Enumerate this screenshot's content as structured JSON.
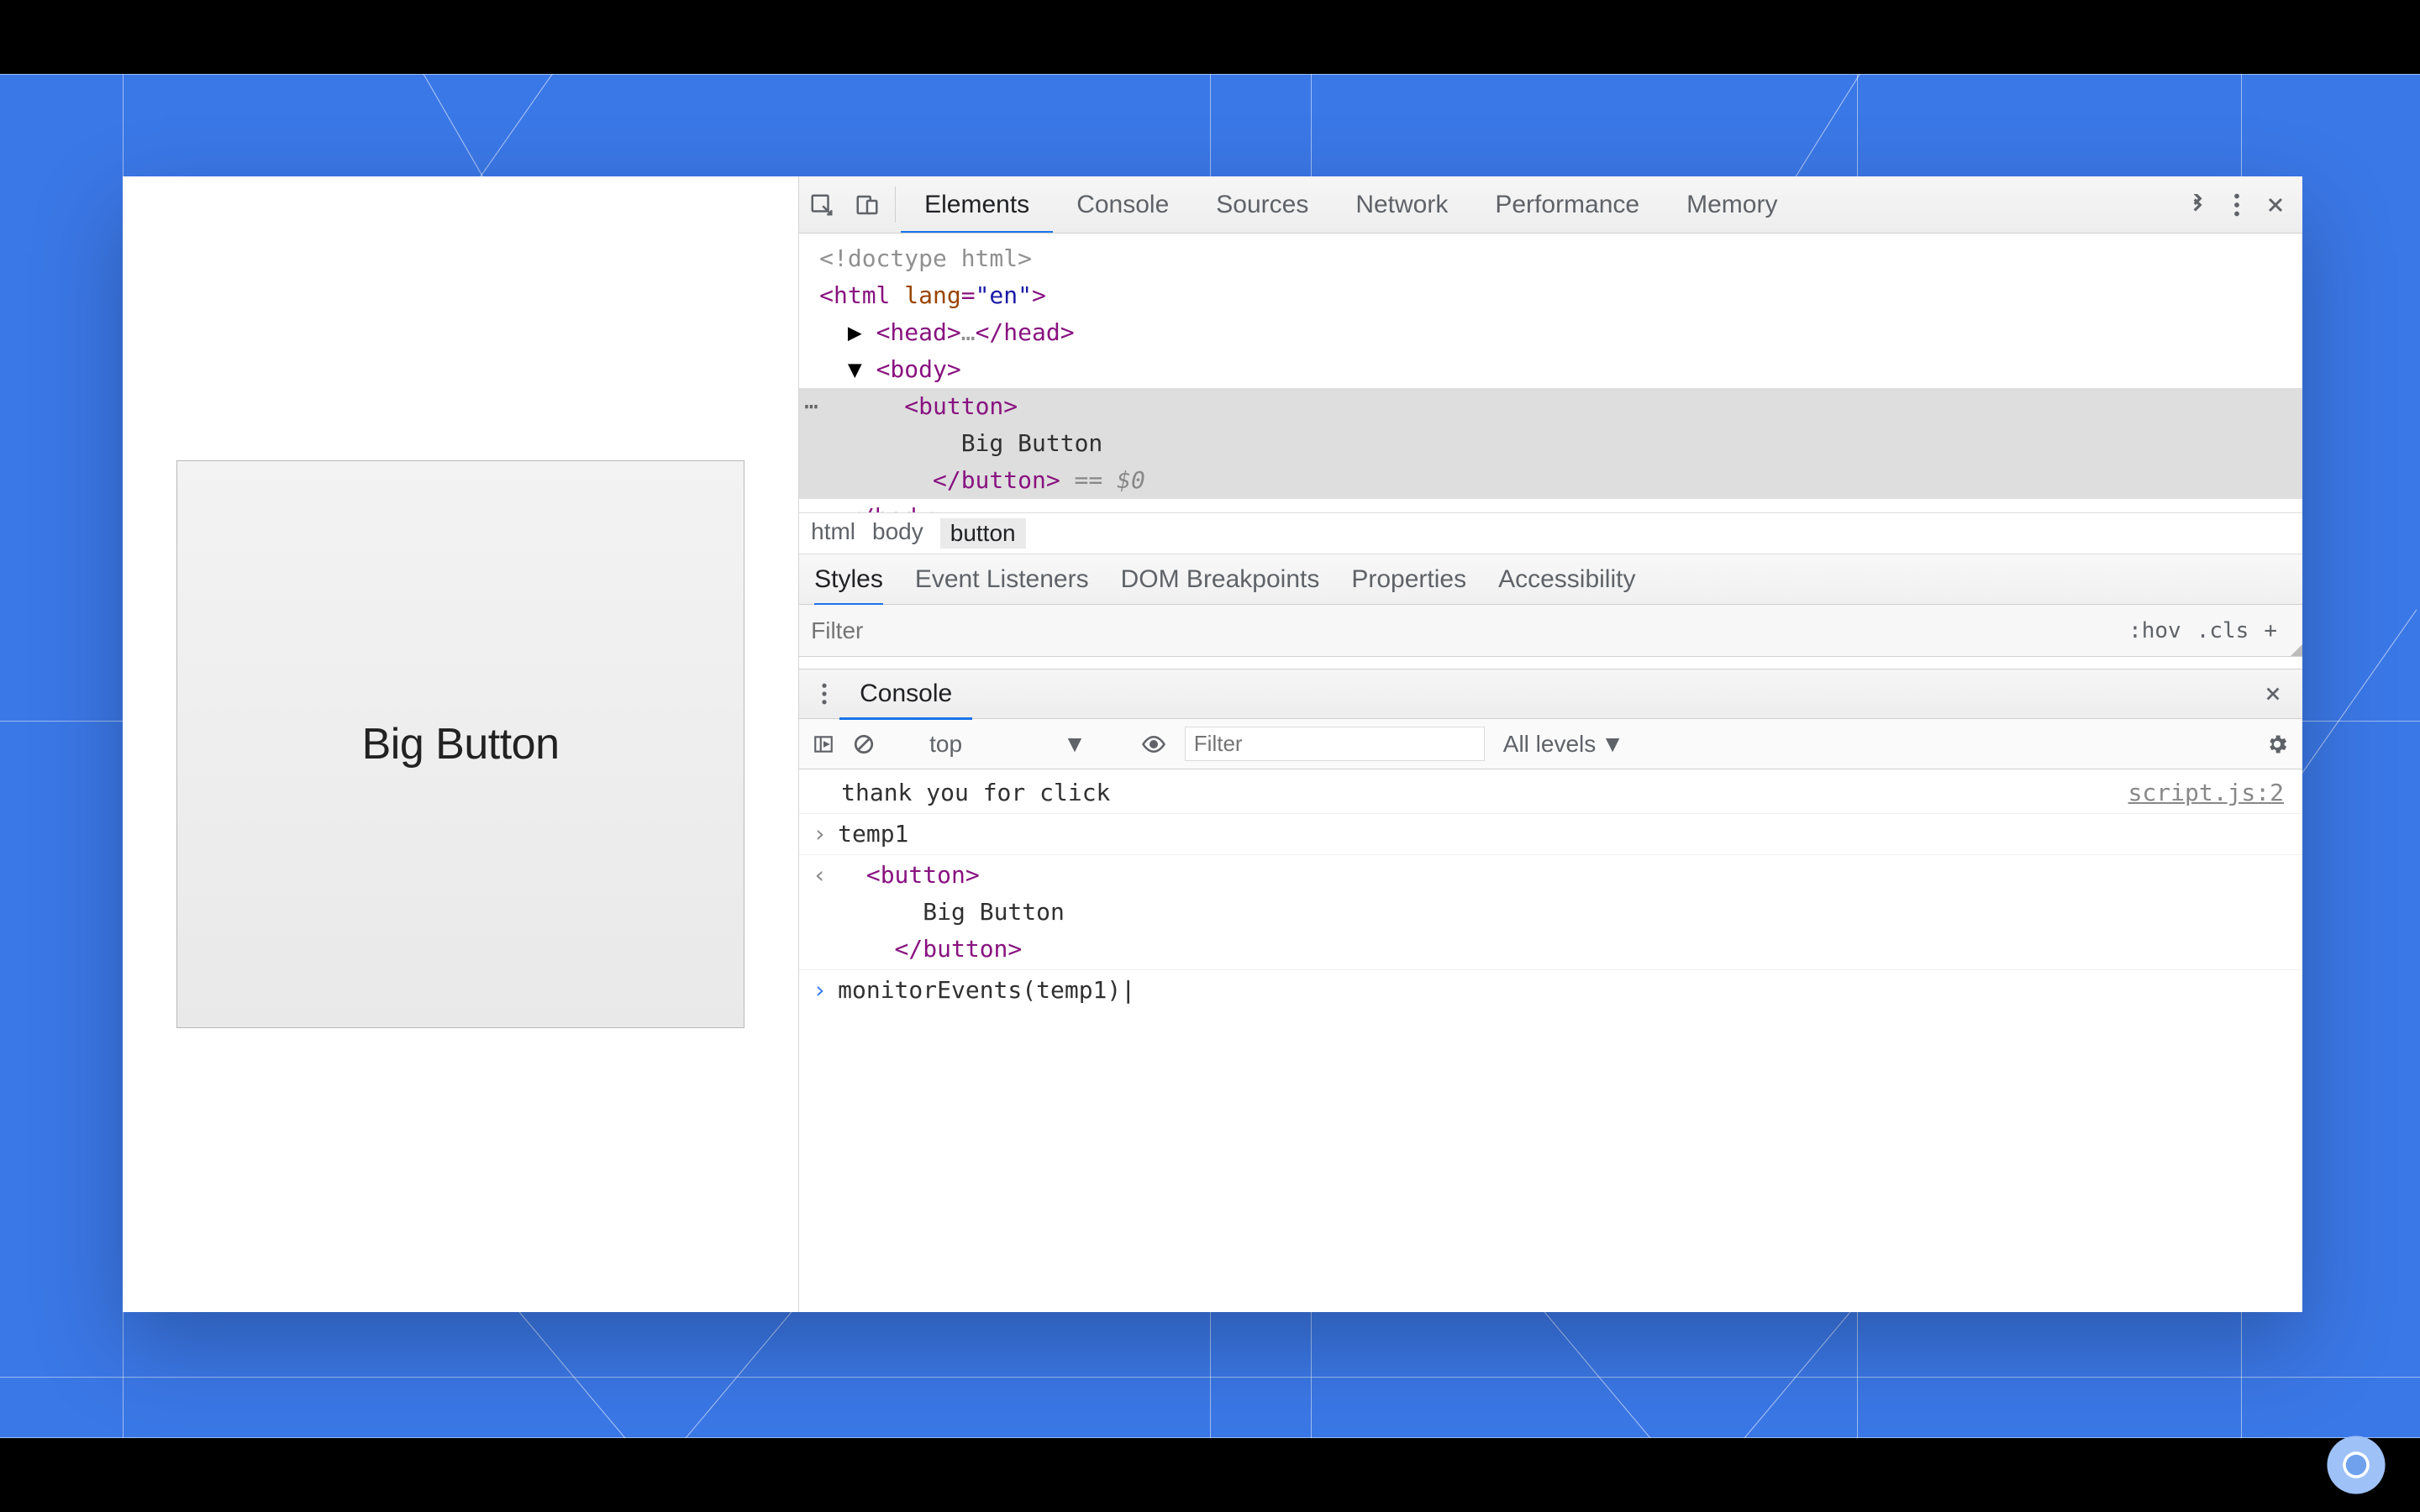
{
  "page": {
    "big_button_label": "Big Button"
  },
  "devtools": {
    "tabs": {
      "elements": "Elements",
      "console": "Console",
      "sources": "Sources",
      "network": "Network",
      "performance": "Performance",
      "memory": "Memory"
    },
    "tree": {
      "doctype": "<!doctype html>",
      "html_open": "<html lang=\"en\">",
      "head": "<head>…</head>",
      "body_open": "<body>",
      "button_open": "<button>",
      "button_text": "Big Button",
      "button_close": "</button>",
      "sel_ref": " == $0",
      "body_close": "</body>"
    },
    "breadcrumb": {
      "html": "html",
      "body": "body",
      "button": "button"
    },
    "subtabs": {
      "styles": "Styles",
      "events": "Event Listeners",
      "dom": "DOM Breakpoints",
      "props": "Properties",
      "a11y": "Accessibility"
    },
    "filter": {
      "placeholder": "Filter",
      "hov": ":hov",
      "cls": ".cls",
      "plus": "+"
    },
    "drawer": {
      "tab": "Console",
      "context": "top",
      "filter_placeholder": "Filter",
      "levels": "All levels"
    },
    "console": {
      "log_msg": "thank you for click",
      "log_src": "script.js:2",
      "temp_var": "temp1",
      "out_button_open": "<button>",
      "out_button_text": "Big Button",
      "out_button_close": "</button>",
      "input": "monitorEvents(temp1)"
    }
  }
}
